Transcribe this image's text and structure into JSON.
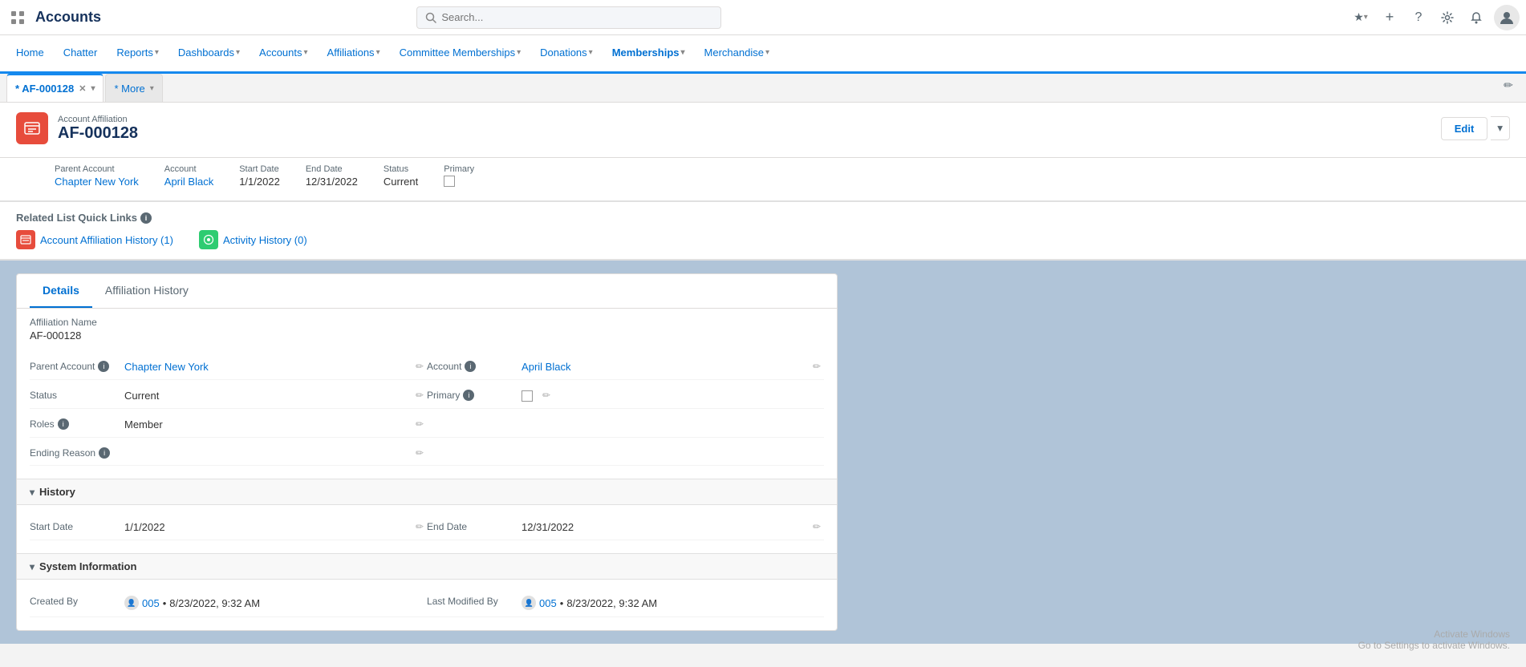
{
  "topBar": {
    "appName": "Accounts",
    "searchPlaceholder": "Search...",
    "icons": {
      "appLauncher": "⠿",
      "star": "★",
      "add": "+",
      "help": "?",
      "setup": "⚙",
      "notification": "🔔",
      "avatar": "👤"
    }
  },
  "mainNav": {
    "items": [
      {
        "label": "Home",
        "hasDropdown": false
      },
      {
        "label": "Chatter",
        "hasDropdown": false
      },
      {
        "label": "Reports",
        "hasDropdown": true
      },
      {
        "label": "Dashboards",
        "hasDropdown": true
      },
      {
        "label": "Accounts",
        "hasDropdown": true
      },
      {
        "label": "Affiliations",
        "hasDropdown": true
      },
      {
        "label": "Committee Memberships",
        "hasDropdown": true
      },
      {
        "label": "Donations",
        "hasDropdown": true
      },
      {
        "label": "Memberships",
        "hasDropdown": true
      },
      {
        "label": "Merchandise",
        "hasDropdown": true
      }
    ]
  },
  "tabsBar": {
    "tabs": [
      {
        "label": "* AF-000128",
        "active": true,
        "closeable": true
      },
      {
        "label": "* More",
        "active": false,
        "closeable": false
      }
    ],
    "editIcon": "✏"
  },
  "recordHeader": {
    "iconSymbol": "≡",
    "typeLabel": "Account Affiliation",
    "recordName": "AF-000128",
    "editLabel": "Edit"
  },
  "fieldsRow": {
    "fields": [
      {
        "label": "Parent Account",
        "value": "Chapter New York",
        "isLink": true
      },
      {
        "label": "Account",
        "value": "April Black",
        "isLink": true
      },
      {
        "label": "Start Date",
        "value": "1/1/2022",
        "isLink": false
      },
      {
        "label": "End Date",
        "value": "12/31/2022",
        "isLink": false
      },
      {
        "label": "Status",
        "value": "Current",
        "isLink": false
      },
      {
        "label": "Primary",
        "value": "checkbox",
        "isLink": false
      }
    ]
  },
  "quickLinks": {
    "sectionTitle": "Related List Quick Links",
    "items": [
      {
        "label": "Account Affiliation History (1)",
        "badgeColor": "#e74c3c",
        "badgeText": "≡"
      },
      {
        "label": "Activity History (0)",
        "badgeColor": "#2ecc71",
        "badgeText": "⊙"
      }
    ]
  },
  "detailsPanel": {
    "tabs": [
      {
        "label": "Details",
        "active": true
      },
      {
        "label": "Affiliation History",
        "active": false
      }
    ],
    "affiliationNameLabel": "Affiliation Name",
    "affiliationNameValue": "AF-000128",
    "fields": [
      {
        "left": {
          "label": "Parent Account",
          "hasInfo": true,
          "value": "Chapter New York",
          "isLink": true
        },
        "right": {
          "label": "Account",
          "hasInfo": true,
          "value": "April Black",
          "isLink": true
        }
      },
      {
        "left": {
          "label": "Status",
          "hasInfo": false,
          "value": "Current",
          "isLink": false
        },
        "right": {
          "label": "Primary",
          "hasInfo": true,
          "value": "checkbox",
          "isLink": false
        }
      },
      {
        "left": {
          "label": "Roles",
          "hasInfo": true,
          "value": "Member",
          "isLink": false
        },
        "right": {
          "label": "",
          "hasInfo": false,
          "value": "",
          "isLink": false
        }
      },
      {
        "left": {
          "label": "Ending Reason",
          "hasInfo": true,
          "value": "",
          "isLink": false
        },
        "right": {
          "label": "",
          "hasInfo": false,
          "value": "",
          "isLink": false
        }
      }
    ],
    "historySectionLabel": "History",
    "historyFields": [
      {
        "left": {
          "label": "Start Date",
          "value": "1/1/2022"
        },
        "right": {
          "label": "End Date",
          "value": "12/31/2022"
        }
      }
    ],
    "systemSectionLabel": "System Information",
    "systemFields": [
      {
        "left": {
          "label": "Created By",
          "value": "005 • 8/23/2022, 9:32 AM"
        },
        "right": {
          "label": "Last Modified By",
          "value": "005 • 8/23/2022, 9:32 AM"
        }
      }
    ]
  },
  "watermark": {
    "line1": "Activate Windows",
    "line2": "Go to Settings to activate Windows."
  }
}
